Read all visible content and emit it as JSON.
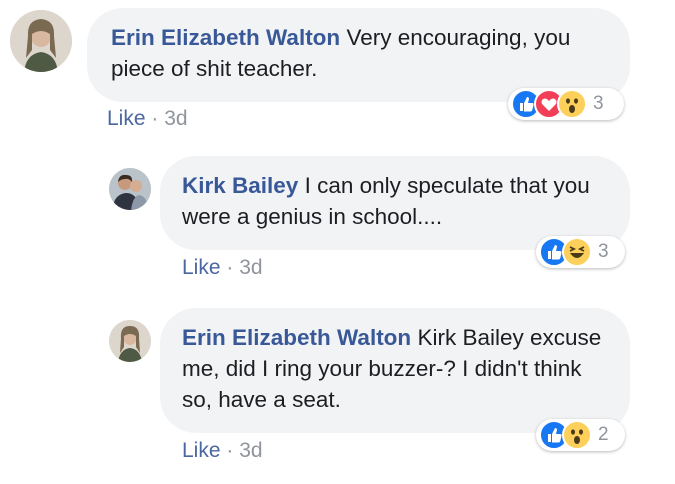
{
  "comments": [
    {
      "author": "Erin Elizabeth Walton",
      "text": "Very encouraging, you piece of shit teacher.",
      "like_label": "Like",
      "separator": "·",
      "age": "3d",
      "reactions": [
        "like",
        "love",
        "wow"
      ],
      "reaction_count": "3"
    },
    {
      "author": "Kirk Bailey",
      "text": "I can only speculate that you were a genius in school....",
      "like_label": "Like",
      "separator": "·",
      "age": "3d",
      "reactions": [
        "like",
        "haha"
      ],
      "reaction_count": "3"
    },
    {
      "author": "Erin Elizabeth Walton",
      "text": "Kirk Bailey excuse me, did I ring your buzzer-? I didn't think so, have a seat.",
      "like_label": "Like",
      "separator": "·",
      "age": "3d",
      "reactions": [
        "like",
        "wow"
      ],
      "reaction_count": "2"
    }
  ],
  "colors": {
    "author_link": "#385898",
    "like_link": "#4b67a1",
    "meta_gray": "#90949c",
    "bubble_bg": "#f2f3f5",
    "like_blue": "#1877f2",
    "love_red": "#f33e58",
    "emoji_yellow": "#fcd05b"
  }
}
